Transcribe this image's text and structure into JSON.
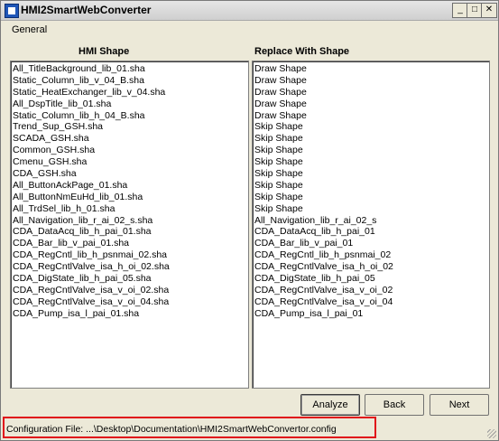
{
  "window": {
    "title": "HMI2SmartWebConverter"
  },
  "titlebar": {
    "minimize": "_",
    "maximize": "□",
    "close": "✕"
  },
  "menu": {
    "general": "General"
  },
  "left_panel": {
    "header": "HMI Shape",
    "items": [
      "All_TitleBackground_lib_01.sha",
      "Static_Column_lib_v_04_B.sha",
      "Static_HeatExchanger_lib_v_04.sha",
      "All_DspTitle_lib_01.sha",
      "Static_Column_lib_h_04_B.sha",
      "Trend_Sup_GSH.sha",
      "SCADA_GSH.sha",
      "Common_GSH.sha",
      "Cmenu_GSH.sha",
      "CDA_GSH.sha",
      "All_ButtonAckPage_01.sha",
      "All_ButtonNmEuHd_lib_01.sha",
      "All_TrdSel_lib_h_01.sha",
      "All_Navigation_lib_r_ai_02_s.sha",
      "CDA_DataAcq_lib_h_pai_01.sha",
      "CDA_Bar_lib_v_pai_01.sha",
      "CDA_RegCntl_lib_h_psnmai_02.sha",
      "CDA_RegCntlValve_isa_h_oi_02.sha",
      "CDA_DigState_lib_h_pai_05.sha",
      "CDA_RegCntlValve_isa_v_oi_02.sha",
      "CDA_RegCntlValve_isa_v_oi_04.sha",
      "CDA_Pump_isa_l_pai_01.sha"
    ]
  },
  "right_panel": {
    "header": "Replace With Shape",
    "items": [
      "Draw Shape",
      "Draw Shape",
      "Draw Shape",
      "Draw Shape",
      "Draw Shape",
      "Skip Shape",
      "Skip Shape",
      "Skip Shape",
      "Skip Shape",
      "Skip Shape",
      "Skip Shape",
      "Skip Shape",
      "Skip Shape",
      "All_Navigation_lib_r_ai_02_s",
      "CDA_DataAcq_lib_h_pai_01",
      "CDA_Bar_lib_v_pai_01",
      "CDA_RegCntl_lib_h_psnmai_02",
      "CDA_RegCntlValve_isa_h_oi_02",
      "CDA_DigState_lib_h_pai_05",
      "CDA_RegCntlValve_isa_v_oi_02",
      "CDA_RegCntlValve_isa_v_oi_04",
      "CDA_Pump_isa_l_pai_01"
    ]
  },
  "buttons": {
    "analyze": "Analyze",
    "back": "Back",
    "next": "Next"
  },
  "status": {
    "text": "Configuration File:  ...\\Desktop\\Documentation\\HMI2SmartWebConvertor.config"
  },
  "colors": {
    "highlight": "#e0101a"
  }
}
